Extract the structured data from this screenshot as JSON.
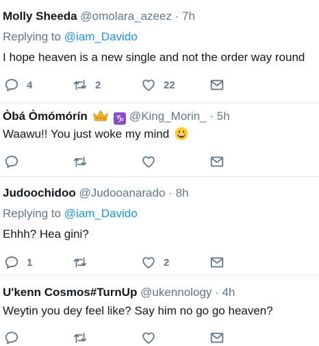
{
  "tweets": [
    {
      "name": "Molly Sheeda",
      "handle": "@omolara_azeez",
      "sep": "·",
      "time": "7h",
      "replying_prefix": "Replying to ",
      "replying_to": "@iam_Davido",
      "text": "I hope heaven is a new single and not the order way round",
      "reply_count": "4",
      "retweet_count": "2",
      "like_count": "22"
    },
    {
      "name": "Òbá Òmómórín",
      "handle": "@King_Morin_",
      "sep": "·",
      "time": "5h",
      "capricorn_symbol": "♑",
      "text": "Waawu!! You just woke my mind"
    },
    {
      "name": "Judoochidoo",
      "handle": "@Judooanarado",
      "sep": "·",
      "time": "8h",
      "replying_prefix": "Replying to ",
      "replying_to": "@iam_Davido",
      "text": "Ehhh? Hea gini?",
      "reply_count": "1",
      "like_count": "2"
    },
    {
      "name": "U'kenn Cosmos#TurnUp",
      "handle": "@ukennology",
      "sep": "·",
      "time": "4h",
      "text": "Weytin you dey feel like? Say him no go go heaven?"
    }
  ],
  "colors": {
    "text": "#14171a",
    "muted": "#657786",
    "link": "#1b95e0",
    "divider": "#e6ecf0"
  }
}
